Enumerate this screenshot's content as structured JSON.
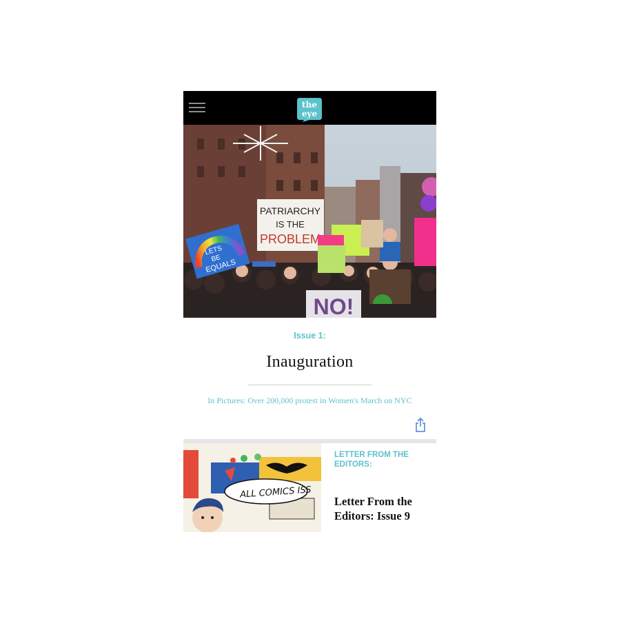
{
  "header": {
    "logo_text_line1": "the",
    "logo_text_line2": "eye",
    "logo_color": "#5cc2cb",
    "menu_icon": "hamburger-menu-icon"
  },
  "hero": {
    "signs": {
      "patriarchy_line1": "PATRIARCHY",
      "patriarchy_line2": "IS THE",
      "patriarchy_line3": "PROBLEM",
      "equals_line1": "LETS",
      "equals_line2": "BE",
      "equals_line3": "EQUALS",
      "no": "NO!"
    }
  },
  "issue": {
    "label": "Issue 1:",
    "title": "Inauguration",
    "article_link": "In Pictures: Over 200,000 protest in Women's March on NYC",
    "share_icon": "share-icon"
  },
  "card": {
    "category": "LETTER FROM THE EDITORS:",
    "title": "Letter From the Editors: Issue 9",
    "thumb_text": "ALL COMICS ISS"
  },
  "colors": {
    "accent": "#5cc2cb",
    "topbar": "#000000",
    "text": "#111111"
  }
}
